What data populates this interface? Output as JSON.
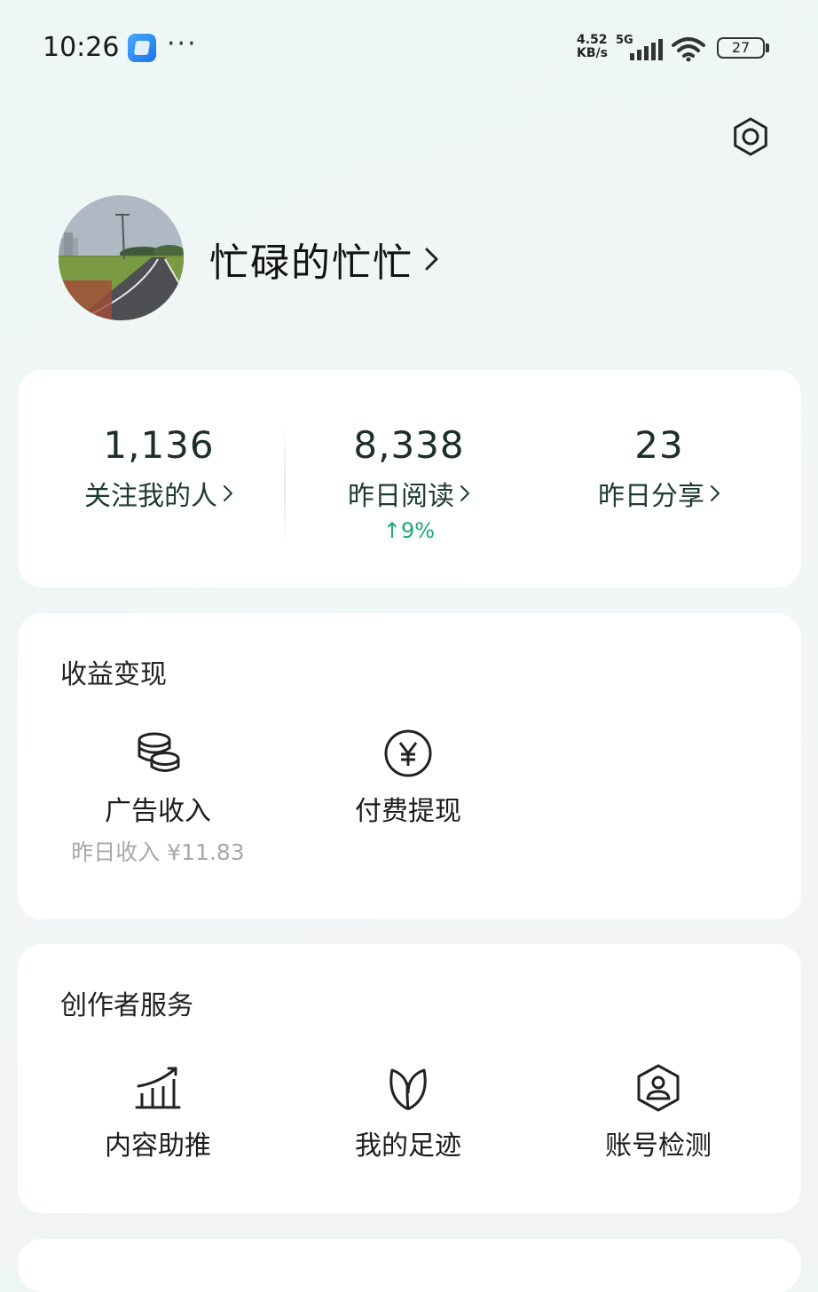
{
  "status_bar": {
    "time": "10:26",
    "net_speed_value": "4.52",
    "net_speed_unit": "KB/s",
    "network_type": "5G",
    "battery": "27"
  },
  "profile": {
    "username": "忙碌的忙忙"
  },
  "stats": [
    {
      "value": "1,136",
      "label": "关注我的人"
    },
    {
      "value": "8,338",
      "label": "昨日阅读",
      "trend": "↑9%"
    },
    {
      "value": "23",
      "label": "昨日分享"
    }
  ],
  "income": {
    "title": "收益变现",
    "items": [
      {
        "label": "广告收入",
        "sub": "昨日收入 ¥11.83",
        "icon": "coins-icon"
      },
      {
        "label": "付费提现",
        "icon": "yuan-circle-icon"
      }
    ]
  },
  "creator": {
    "title": "创作者服务",
    "items": [
      {
        "label": "内容助推",
        "icon": "growth-chart-icon"
      },
      {
        "label": "我的足迹",
        "icon": "leaf-sprout-icon"
      },
      {
        "label": "账号检测",
        "icon": "account-shield-icon"
      }
    ]
  },
  "colors": {
    "accent_green": "#1aa874",
    "stat_text": "#1d3a33",
    "card_bg": "#ffffff"
  }
}
